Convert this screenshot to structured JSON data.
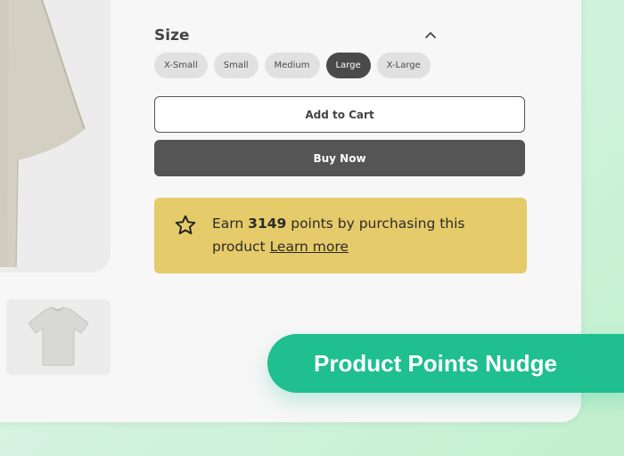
{
  "size": {
    "label": "Size",
    "options": [
      "X-Small",
      "Small",
      "Medium",
      "Large",
      "X-Large"
    ],
    "selected": "Large"
  },
  "actions": {
    "add_to_cart": "Add to  Cart",
    "buy_now": "Buy Now"
  },
  "points_nudge": {
    "prefix": "Earn",
    "points": "3149",
    "suffix": "points by purchasing this product",
    "link": "Learn more",
    "background": "#e5cb69"
  },
  "banner": {
    "title": "Product Points Nudge",
    "color": "#1fbf8f"
  },
  "icons": [
    "chevron-up-icon",
    "star-icon"
  ]
}
